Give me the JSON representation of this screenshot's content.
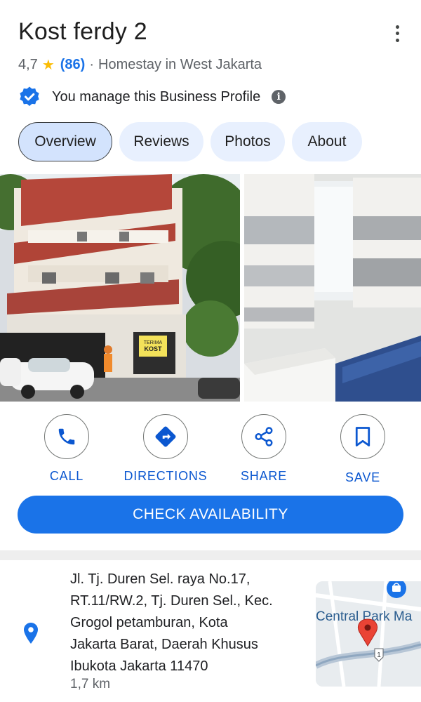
{
  "place": {
    "name": "Kost ferdy 2",
    "rating": "4,7",
    "review_count": "(86)",
    "separator": "·",
    "category": "Homestay in West Jakarta"
  },
  "manage": {
    "text": "You manage this Business Profile",
    "info_icon": "i"
  },
  "tabs": [
    {
      "label": "Overview",
      "active": true
    },
    {
      "label": "Reviews",
      "active": false
    },
    {
      "label": "Photos",
      "active": false
    },
    {
      "label": "About",
      "active": false
    }
  ],
  "photos": {
    "sign_line1": "TERIMA",
    "sign_line2": "KOST"
  },
  "actions": {
    "call": "CALL",
    "directions": "DIRECTIONS",
    "share": "SHARE",
    "save": "SAVE"
  },
  "cta": {
    "label": "CHECK AVAILABILITY"
  },
  "address": {
    "lines": [
      "Jl. Tj. Duren Sel. raya No.17,",
      "RT.11/RW.2, Tj. Duren Sel., Kec.",
      "Grogol petamburan, Kota",
      "Jakarta Barat, Daerah Khusus",
      "Ibukota Jakarta 11470"
    ],
    "distance": "1,7 km"
  },
  "map": {
    "label": "Central Park Ma",
    "road_number": "1"
  },
  "colors": {
    "accent": "#1a73e8",
    "tab_bg": "#e8f0fe",
    "star": "#fbbc04",
    "pin": "#1a73e8",
    "map_marker": "#ea4335"
  }
}
